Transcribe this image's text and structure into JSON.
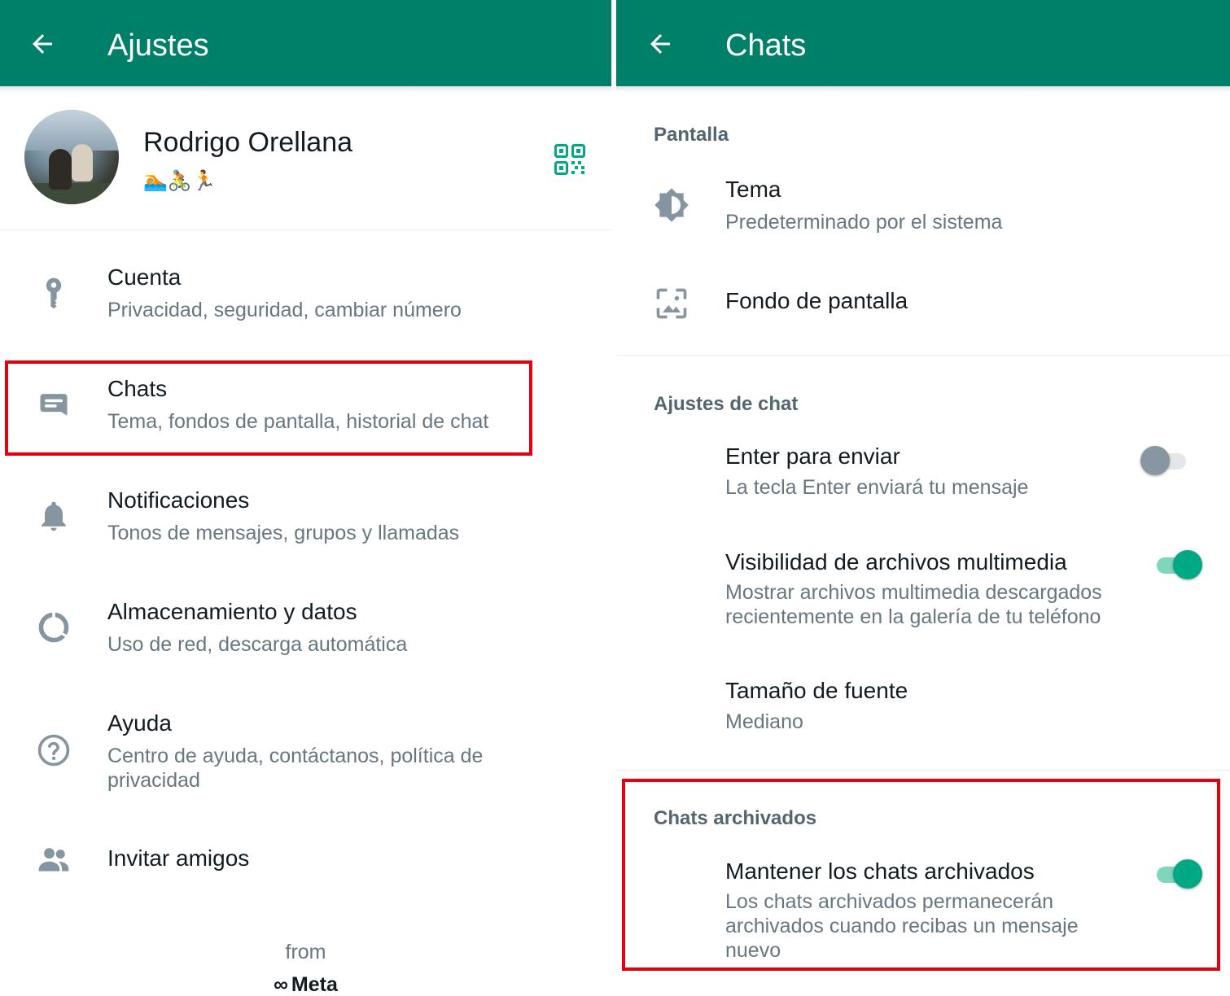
{
  "left": {
    "appbar": {
      "title": "Ajustes"
    },
    "profile": {
      "name": "Rodrigo Orellana",
      "status": "🏊🚴🏃"
    },
    "items": [
      {
        "title": "Cuenta",
        "subtitle": "Privacidad, seguridad, cambiar número",
        "icon": "key-icon"
      },
      {
        "title": "Chats",
        "subtitle": "Tema, fondos de pantalla, historial de chat",
        "icon": "chat-icon"
      },
      {
        "title": "Notificaciones",
        "subtitle": "Tonos de mensajes, grupos y llamadas",
        "icon": "bell-icon"
      },
      {
        "title": "Almacenamiento y datos",
        "subtitle": "Uso de red, descarga automática",
        "icon": "storage-icon"
      },
      {
        "title": "Ayuda",
        "subtitle": "Centro de ayuda, contáctanos, política de privacidad",
        "icon": "help-icon"
      },
      {
        "title": "Invitar amigos",
        "subtitle": "",
        "icon": "people-icon"
      }
    ],
    "footer": {
      "from": "from",
      "brand": "Meta"
    }
  },
  "right": {
    "appbar": {
      "title": "Chats"
    },
    "sections": {
      "display": "Pantalla",
      "chat_settings": "Ajustes de chat",
      "archived": "Chats archivados"
    },
    "display_items": [
      {
        "title": "Tema",
        "subtitle": "Predeterminado por el sistema",
        "icon": "theme-icon"
      },
      {
        "title": "Fondo de pantalla",
        "subtitle": "",
        "icon": "wallpaper-icon"
      }
    ],
    "chat_items": [
      {
        "title": "Enter para enviar",
        "subtitle": "La tecla Enter enviará tu mensaje",
        "toggle": false
      },
      {
        "title": "Visibilidad de archivos multimedia",
        "subtitle": "Mostrar archivos multimedia descargados recientemente en la galería de tu teléfono",
        "toggle": true
      },
      {
        "title": "Tamaño de fuente",
        "subtitle": "Mediano"
      }
    ],
    "archived_item": {
      "title": "Mantener los chats archivados",
      "subtitle": "Los chats archivados permanecerán archivados cuando recibas un mensaje nuevo",
      "toggle": true
    }
  },
  "colors": {
    "appbar": "#008069",
    "accent": "#00a884",
    "highlight": "#e3000f"
  }
}
